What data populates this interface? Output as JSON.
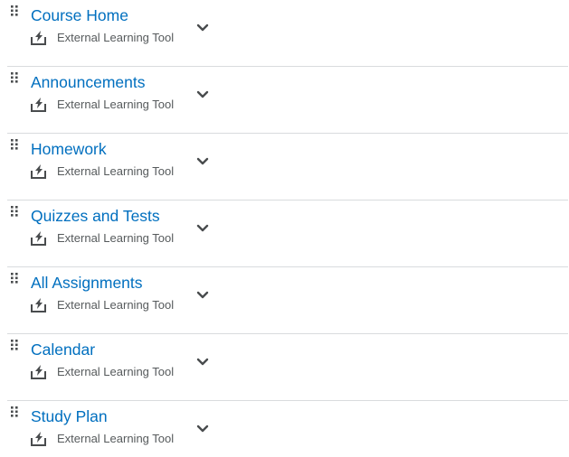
{
  "modules": [
    {
      "title": "Course Home",
      "type": "External Learning Tool"
    },
    {
      "title": "Announcements",
      "type": "External Learning Tool"
    },
    {
      "title": "Homework",
      "type": "External Learning Tool"
    },
    {
      "title": "Quizzes and Tests",
      "type": "External Learning Tool"
    },
    {
      "title": "All Assignments",
      "type": "External Learning Tool"
    },
    {
      "title": "Calendar",
      "type": "External Learning Tool"
    },
    {
      "title": "Study Plan",
      "type": "External Learning Tool"
    }
  ],
  "icons": {
    "drag": "drag-handle-icon",
    "tool": "external-tool-icon",
    "expand": "chevron-down-icon"
  },
  "colors": {
    "link": "#006fbf",
    "subtitle": "#565a5c",
    "icon": "#494c4e",
    "divider": "#d9dbde"
  }
}
